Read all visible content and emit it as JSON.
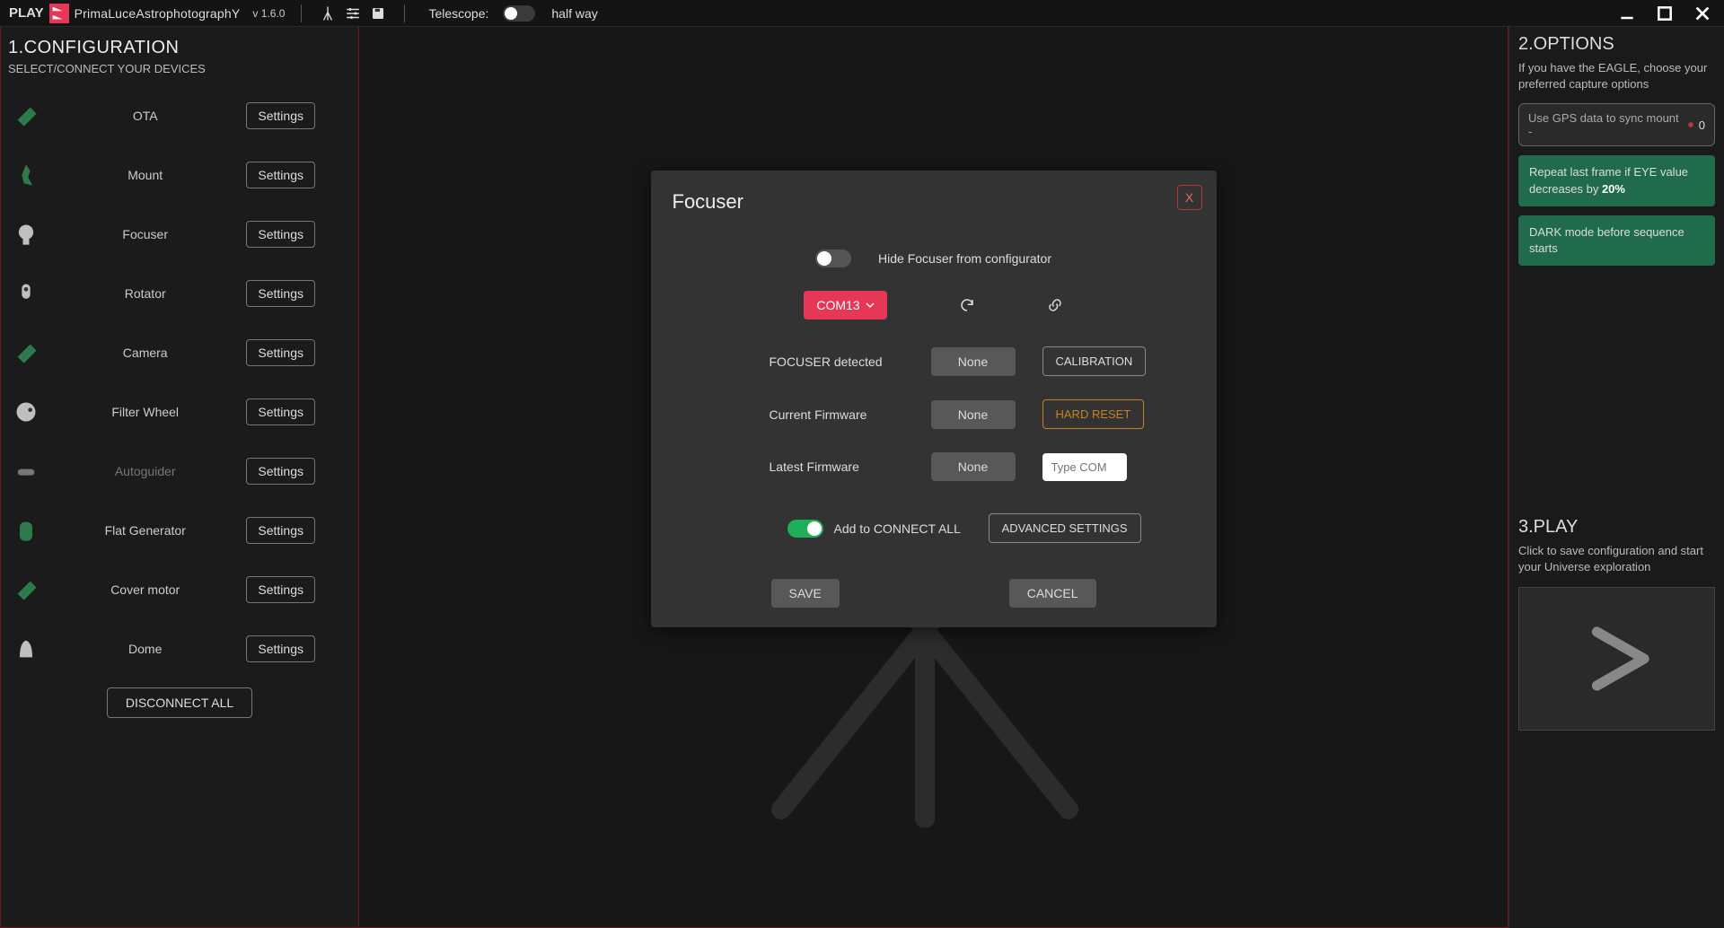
{
  "app": {
    "play": "PLAY",
    "brand": "PrimaLuceAstrophotographY",
    "version": "v 1.6.0",
    "telescope_label": "Telescope:",
    "status_text": "half way"
  },
  "configuration": {
    "title": "1.CONFIGURATION",
    "subtitle": "SELECT/CONNECT YOUR DEVICES",
    "settings_label": "Settings",
    "disconnect_all": "DISCONNECT ALL",
    "devices": [
      {
        "name": "OTA",
        "color": "#2f7a4d",
        "muted": false
      },
      {
        "name": "Mount",
        "color": "#2f7a4d",
        "muted": false
      },
      {
        "name": "Focuser",
        "color": "#bfbfbf",
        "muted": false
      },
      {
        "name": "Rotator",
        "color": "#bfbfbf",
        "muted": false
      },
      {
        "name": "Camera",
        "color": "#2f7a4d",
        "muted": false
      },
      {
        "name": "Filter Wheel",
        "color": "#bfbfbf",
        "muted": false
      },
      {
        "name": "Autoguider",
        "color": "#777",
        "muted": true
      },
      {
        "name": "Flat Generator",
        "color": "#2f7a4d",
        "muted": false
      },
      {
        "name": "Cover motor",
        "color": "#2f7a4d",
        "muted": false
      },
      {
        "name": "Dome",
        "color": "#bfbfbf",
        "muted": false
      }
    ]
  },
  "options": {
    "title": "2.OPTIONS",
    "desc": "If you have the EAGLE, choose your preferred capture options",
    "gps_text": "Use GPS data to sync mount  -",
    "gps_badge": "0",
    "repeat_text": "Repeat last frame if EYE value decreases by ",
    "repeat_pct": "20%",
    "dark_text": "DARK mode before sequence starts"
  },
  "playsect": {
    "title": "3.PLAY",
    "desc": "Click to save configuration and start your Universe exploration"
  },
  "modal": {
    "title": "Focuser",
    "close": "X",
    "hide_label": "Hide Focuser from configurator",
    "com_value": "COM13",
    "detected_label": "FOCUSER detected",
    "detected_value": "None",
    "calibration": "CALIBRATION",
    "current_fw_label": "Current Firmware",
    "current_fw_value": "None",
    "hard_reset": "HARD RESET",
    "latest_fw_label": "Latest Firmware",
    "latest_fw_value": "None",
    "type_com_placeholder": "Type COM",
    "add_connect_all": "Add to CONNECT ALL",
    "advanced": "ADVANCED SETTINGS",
    "save": "SAVE",
    "cancel": "CANCEL"
  }
}
